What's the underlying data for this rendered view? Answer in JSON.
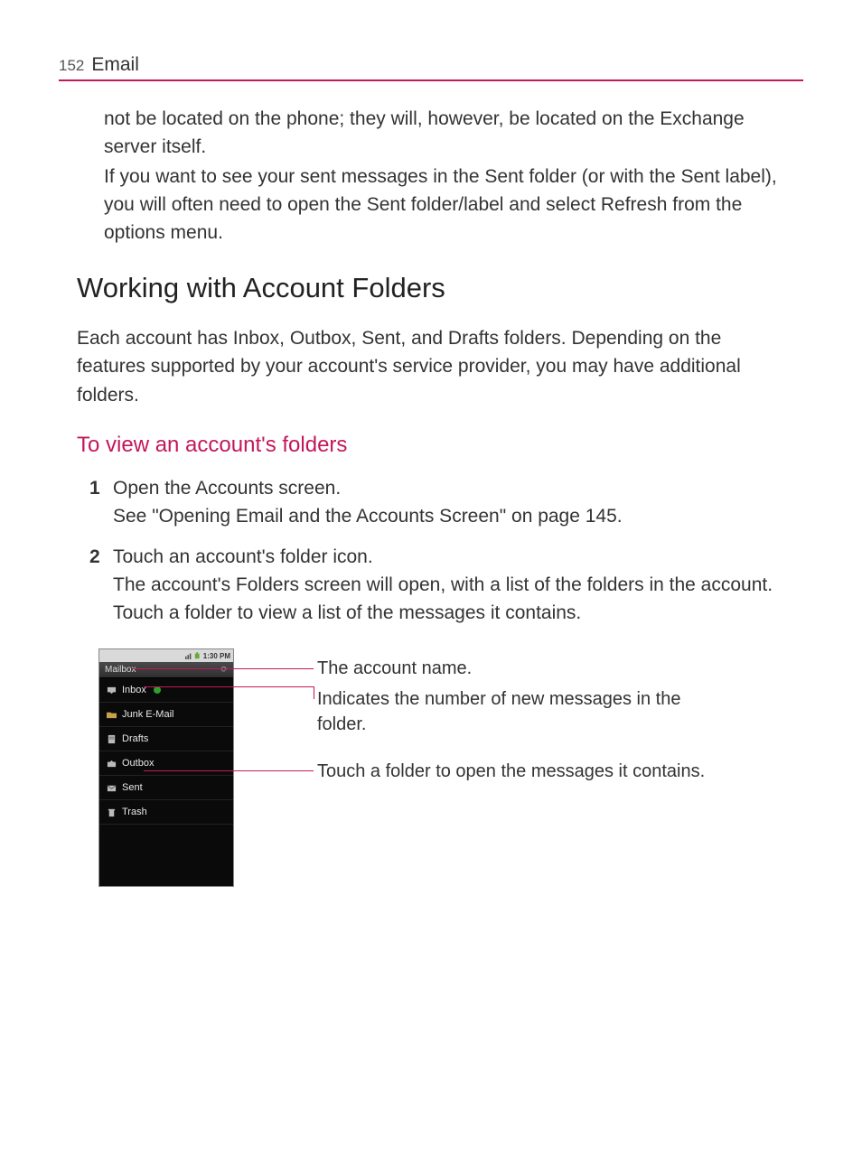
{
  "header": {
    "page_no": "152",
    "section": "Email"
  },
  "para1": "not be located on the phone; they will, however, be located on the Exchange server itself.",
  "para2": "If you want to see your sent messages in the Sent folder (or with the Sent label), you will often need to open the Sent folder/label and select Refresh from the options menu.",
  "heading": "Working with Account Folders",
  "intro": "Each account has Inbox, Outbox, Sent, and Drafts folders. Depending on the features supported by your account's service provider, you may have additional folders.",
  "subheading": "To view an account's folders",
  "steps": [
    {
      "num": "1",
      "lead": "Open the Accounts screen.",
      "rest": "See \"Opening Email and the Accounts Screen\" on page 145."
    },
    {
      "num": "2",
      "lead": "Touch an account's folder icon.",
      "rest": "The account's Folders screen will open, with a list of the folders in the account. Touch a folder to view a list of the messages it contains."
    }
  ],
  "phone": {
    "time": "1:30 PM",
    "title": "Mailbox",
    "folders": [
      {
        "name": "Inbox",
        "icon": "inbox",
        "badge": true
      },
      {
        "name": "Junk E-Mail",
        "icon": "folder"
      },
      {
        "name": "Drafts",
        "icon": "drafts"
      },
      {
        "name": "Outbox",
        "icon": "outbox"
      },
      {
        "name": "Sent",
        "icon": "sent"
      },
      {
        "name": "Trash",
        "icon": "trash"
      }
    ]
  },
  "callouts": {
    "c1": "The account name.",
    "c2": "Indicates the number of new messages in the folder.",
    "c3": "Touch a folder to open the messages it contains."
  }
}
